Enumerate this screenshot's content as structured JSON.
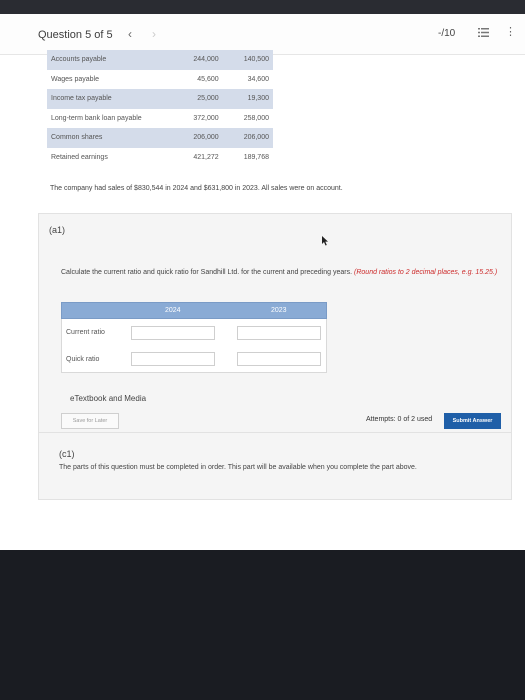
{
  "header": {
    "question_label": "Question 5 of 5",
    "prev_glyph": "‹",
    "next_glyph": "›",
    "score": "-/10"
  },
  "balances": {
    "rows": [
      {
        "label": "Accounts payable",
        "y2024": "244,000",
        "y2023": "140,500"
      },
      {
        "label": "Wages payable",
        "y2024": "45,600",
        "y2023": "34,600"
      },
      {
        "label": "Income tax payable",
        "y2024": "25,000",
        "y2023": "19,300"
      },
      {
        "label": "Long-term bank loan payable",
        "y2024": "372,000",
        "y2023": "258,000"
      },
      {
        "label": "Common shares",
        "y2024": "206,000",
        "y2023": "206,000"
      },
      {
        "label": "Retained earnings",
        "y2024": "421,272",
        "y2023": "189,768"
      }
    ]
  },
  "sales_note": "The company had sales of $830,544 in 2024 and $631,800 in 2023. All sales were on account.",
  "part_a1": {
    "title": "(a1)",
    "instruction": "Calculate the current ratio and quick ratio for Sandhill Ltd. for the current and preceding years.",
    "instruction_hint": "(Round ratios to 2 decimal places, e.g. 15.25.)",
    "columns": [
      "2024",
      "2023"
    ],
    "rows": [
      {
        "label": "Current ratio",
        "y2024": "",
        "y2023": ""
      },
      {
        "label": "Quick ratio",
        "y2024": "",
        "y2023": ""
      }
    ],
    "etextbook_label": "eTextbook and Media",
    "save_label": "Save for Later",
    "attempts": "Attempts: 0 of 2 used",
    "submit_label": "Submit Answer"
  },
  "part_c1": {
    "title": "(c1)",
    "note": "The parts of this question must be completed in order. This part will be available when you complete the part above."
  },
  "icons": {
    "list": "list-icon",
    "more": "more-vertical-icon",
    "cursor": "mouse-cursor-icon"
  }
}
